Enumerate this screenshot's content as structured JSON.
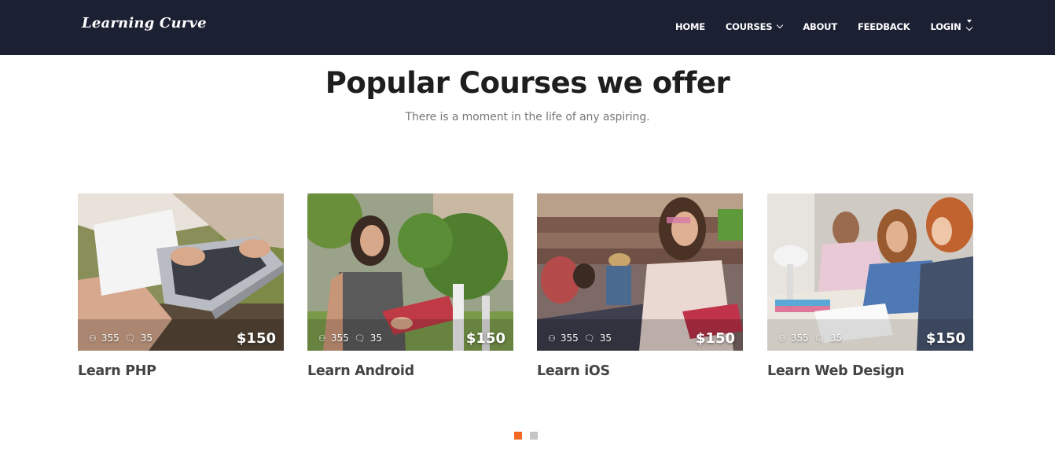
{
  "brand": "Learning Curve",
  "nav": {
    "home": "HOME",
    "courses": "COURSES",
    "about": "ABOUT",
    "feedback": "FEEDBACK",
    "login": "LOGIN"
  },
  "section": {
    "title": "Popular Courses we offer",
    "subtitle": "There is a moment in the life of any aspiring."
  },
  "courses": [
    {
      "title": "Learn PHP",
      "students": "355",
      "comments": "35",
      "price": "$150"
    },
    {
      "title": "Learn Android",
      "students": "355",
      "comments": "35",
      "price": "$150"
    },
    {
      "title": "Learn iOS",
      "students": "355",
      "comments": "35",
      "price": "$150"
    },
    {
      "title": "Learn Web Design",
      "students": "355",
      "comments": "35",
      "price": "$150"
    }
  ],
  "carousel": {
    "active_index": 0,
    "count": 2
  },
  "colors": {
    "navbar": "#1c2033",
    "accent": "#f26a21",
    "inactive_dot": "#c5c5c5"
  },
  "icons": {
    "students": "users-icon",
    "comments": "comment-icon"
  }
}
